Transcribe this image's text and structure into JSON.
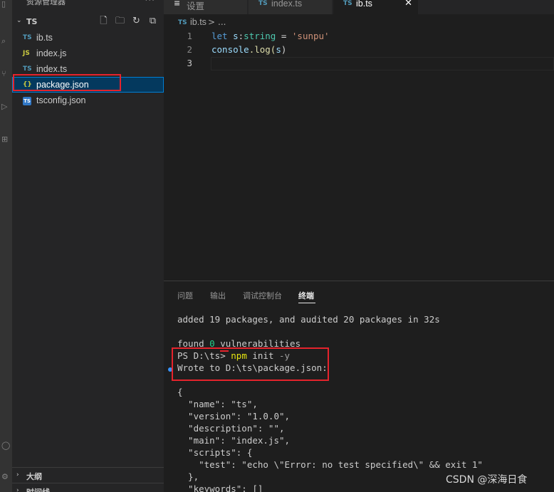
{
  "sidebar": {
    "title": "资源管理器",
    "more": "···",
    "folder": "TS",
    "files": [
      {
        "badge": "TS",
        "name": "ib.ts"
      },
      {
        "badge": "JS",
        "name": "index.js"
      },
      {
        "badge": "TS",
        "name": "index.ts"
      },
      {
        "badge": "{}",
        "name": "package.json"
      },
      {
        "badge": "TS",
        "name": "tsconfig.json"
      }
    ],
    "outline_label": "大纲",
    "timeline_label": "时间线"
  },
  "tabs": [
    {
      "icon": "≡",
      "label": "设置"
    },
    {
      "icon": "TS",
      "label": "index.ts"
    },
    {
      "icon": "TS",
      "label": "ib.ts",
      "close": "✕"
    }
  ],
  "breadcrumb": {
    "icon": "TS",
    "file": "ib.ts",
    "separator": ">",
    "rest": "..."
  },
  "editor": {
    "line_numbers": [
      "1",
      "2",
      "3"
    ],
    "line1": {
      "kw": "let",
      "space": " ",
      "var": "s",
      "colon": ":",
      "type": "string",
      "eq": " = ",
      "str": "'sunpu'"
    },
    "line2": {
      "fn": "console",
      "dot": ".log(",
      "var": "s",
      "close": ")"
    }
  },
  "panel": {
    "tabs": [
      "问题",
      "输出",
      "调试控制台",
      "终端"
    ],
    "active_tab": "终端"
  },
  "terminal": {
    "lines": [
      "added 19 packages, and audited 20 packages in 32s",
      "found ",
      "0",
      " vulnerabilities",
      "PS D:\\ts> ",
      "npm",
      " init ",
      "-y",
      "Wrote to D:\\ts\\package.json:",
      "{",
      "  \"name\": \"ts\",",
      "  \"version\": \"1.0.0\",",
      "  \"description\": \"\",",
      "  \"main\": \"index.js\",",
      "  \"scripts\": {",
      "    \"test\": \"echo \\\"Error: no test specified\\\" && exit 1\"",
      "  },",
      "  \"keywords\": []"
    ]
  },
  "watermark": "CSDN @深海日食"
}
